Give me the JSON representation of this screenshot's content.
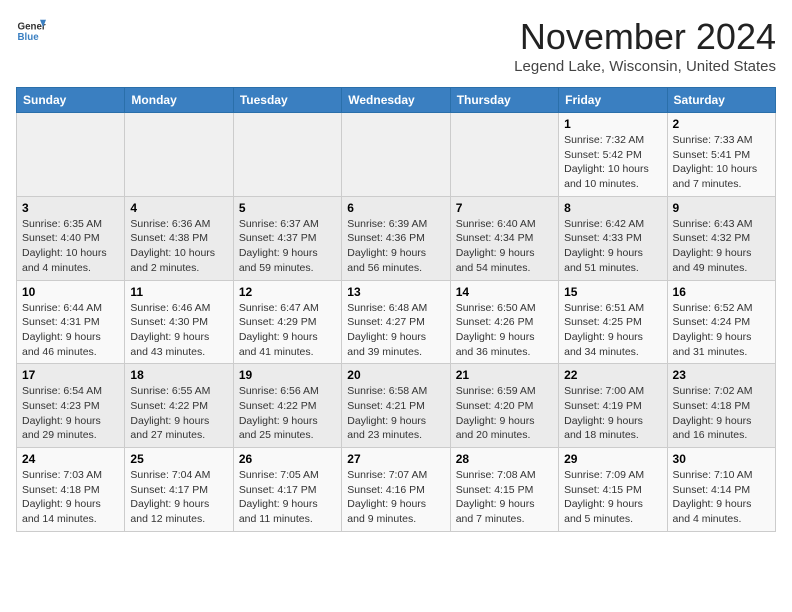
{
  "logo": {
    "general": "General",
    "blue": "Blue"
  },
  "title": "November 2024",
  "location": "Legend Lake, Wisconsin, United States",
  "days_of_week": [
    "Sunday",
    "Monday",
    "Tuesday",
    "Wednesday",
    "Thursday",
    "Friday",
    "Saturday"
  ],
  "weeks": [
    [
      {
        "day": "",
        "info": ""
      },
      {
        "day": "",
        "info": ""
      },
      {
        "day": "",
        "info": ""
      },
      {
        "day": "",
        "info": ""
      },
      {
        "day": "",
        "info": ""
      },
      {
        "day": "1",
        "info": "Sunrise: 7:32 AM\nSunset: 5:42 PM\nDaylight: 10 hours and 10 minutes."
      },
      {
        "day": "2",
        "info": "Sunrise: 7:33 AM\nSunset: 5:41 PM\nDaylight: 10 hours and 7 minutes."
      }
    ],
    [
      {
        "day": "3",
        "info": "Sunrise: 6:35 AM\nSunset: 4:40 PM\nDaylight: 10 hours and 4 minutes."
      },
      {
        "day": "4",
        "info": "Sunrise: 6:36 AM\nSunset: 4:38 PM\nDaylight: 10 hours and 2 minutes."
      },
      {
        "day": "5",
        "info": "Sunrise: 6:37 AM\nSunset: 4:37 PM\nDaylight: 9 hours and 59 minutes."
      },
      {
        "day": "6",
        "info": "Sunrise: 6:39 AM\nSunset: 4:36 PM\nDaylight: 9 hours and 56 minutes."
      },
      {
        "day": "7",
        "info": "Sunrise: 6:40 AM\nSunset: 4:34 PM\nDaylight: 9 hours and 54 minutes."
      },
      {
        "day": "8",
        "info": "Sunrise: 6:42 AM\nSunset: 4:33 PM\nDaylight: 9 hours and 51 minutes."
      },
      {
        "day": "9",
        "info": "Sunrise: 6:43 AM\nSunset: 4:32 PM\nDaylight: 9 hours and 49 minutes."
      }
    ],
    [
      {
        "day": "10",
        "info": "Sunrise: 6:44 AM\nSunset: 4:31 PM\nDaylight: 9 hours and 46 minutes."
      },
      {
        "day": "11",
        "info": "Sunrise: 6:46 AM\nSunset: 4:30 PM\nDaylight: 9 hours and 43 minutes."
      },
      {
        "day": "12",
        "info": "Sunrise: 6:47 AM\nSunset: 4:29 PM\nDaylight: 9 hours and 41 minutes."
      },
      {
        "day": "13",
        "info": "Sunrise: 6:48 AM\nSunset: 4:27 PM\nDaylight: 9 hours and 39 minutes."
      },
      {
        "day": "14",
        "info": "Sunrise: 6:50 AM\nSunset: 4:26 PM\nDaylight: 9 hours and 36 minutes."
      },
      {
        "day": "15",
        "info": "Sunrise: 6:51 AM\nSunset: 4:25 PM\nDaylight: 9 hours and 34 minutes."
      },
      {
        "day": "16",
        "info": "Sunrise: 6:52 AM\nSunset: 4:24 PM\nDaylight: 9 hours and 31 minutes."
      }
    ],
    [
      {
        "day": "17",
        "info": "Sunrise: 6:54 AM\nSunset: 4:23 PM\nDaylight: 9 hours and 29 minutes."
      },
      {
        "day": "18",
        "info": "Sunrise: 6:55 AM\nSunset: 4:22 PM\nDaylight: 9 hours and 27 minutes."
      },
      {
        "day": "19",
        "info": "Sunrise: 6:56 AM\nSunset: 4:22 PM\nDaylight: 9 hours and 25 minutes."
      },
      {
        "day": "20",
        "info": "Sunrise: 6:58 AM\nSunset: 4:21 PM\nDaylight: 9 hours and 23 minutes."
      },
      {
        "day": "21",
        "info": "Sunrise: 6:59 AM\nSunset: 4:20 PM\nDaylight: 9 hours and 20 minutes."
      },
      {
        "day": "22",
        "info": "Sunrise: 7:00 AM\nSunset: 4:19 PM\nDaylight: 9 hours and 18 minutes."
      },
      {
        "day": "23",
        "info": "Sunrise: 7:02 AM\nSunset: 4:18 PM\nDaylight: 9 hours and 16 minutes."
      }
    ],
    [
      {
        "day": "24",
        "info": "Sunrise: 7:03 AM\nSunset: 4:18 PM\nDaylight: 9 hours and 14 minutes."
      },
      {
        "day": "25",
        "info": "Sunrise: 7:04 AM\nSunset: 4:17 PM\nDaylight: 9 hours and 12 minutes."
      },
      {
        "day": "26",
        "info": "Sunrise: 7:05 AM\nSunset: 4:17 PM\nDaylight: 9 hours and 11 minutes."
      },
      {
        "day": "27",
        "info": "Sunrise: 7:07 AM\nSunset: 4:16 PM\nDaylight: 9 hours and 9 minutes."
      },
      {
        "day": "28",
        "info": "Sunrise: 7:08 AM\nSunset: 4:15 PM\nDaylight: 9 hours and 7 minutes."
      },
      {
        "day": "29",
        "info": "Sunrise: 7:09 AM\nSunset: 4:15 PM\nDaylight: 9 hours and 5 minutes."
      },
      {
        "day": "30",
        "info": "Sunrise: 7:10 AM\nSunset: 4:14 PM\nDaylight: 9 hours and 4 minutes."
      }
    ]
  ]
}
